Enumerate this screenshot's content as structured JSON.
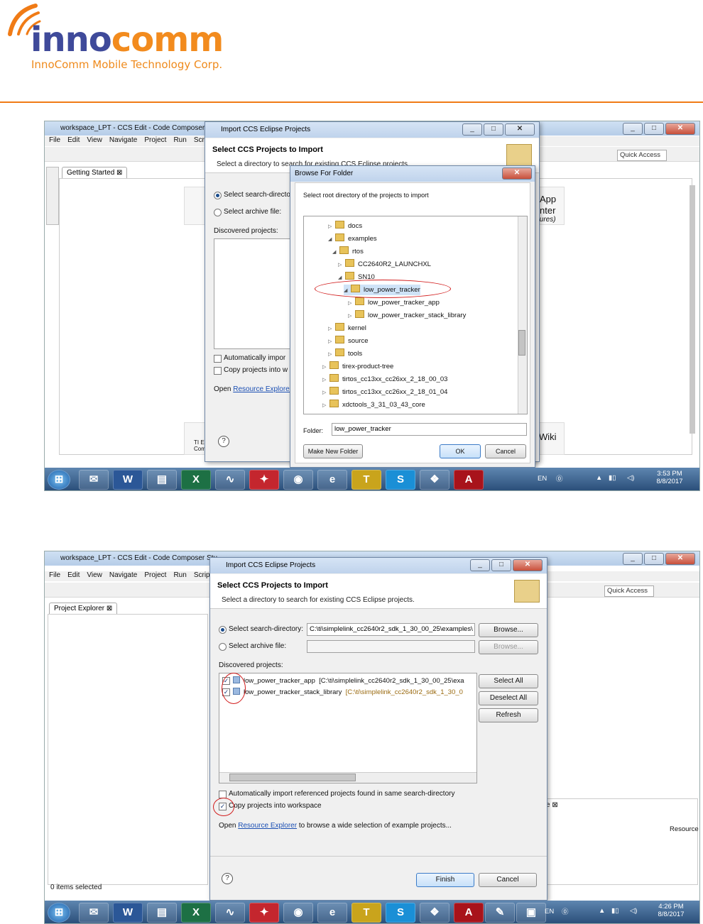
{
  "brand": {
    "logo_a": "inno",
    "logo_b": "comm",
    "tagline": "InnoComm Mobile Technology Corp.",
    "accent": "#f07b16",
    "logo_blue": "#3f4a9a"
  },
  "top": {
    "app_title": "workspace_LPT - CCS Edit - Code Composer Stu",
    "menu": [
      "File",
      "Edit",
      "View",
      "Navigate",
      "Project",
      "Run",
      "Scrip"
    ],
    "quick_access": "Quick Access",
    "editor_tab": "Getting Started",
    "bg_right_1": "App",
    "bg_right_2": "nter",
    "bg_right_3": "tures)",
    "bg_wiki": "Wiki",
    "bg_ti": "TI E",
    "bg_ti2": "Comm",
    "import_dialog": {
      "title": "Import CCS Eclipse Projects",
      "heading": "Select CCS Projects to Import",
      "subheading": "Select a directory to search for existing CCS Eclipse projects.",
      "radio_dir": "Select search-directo",
      "radio_archive": "Select archive file:",
      "discovered": "Discovered projects:",
      "chk_auto": "Automatically impor",
      "chk_copy": "Copy projects into w",
      "open_prefix": "Open",
      "open_link": "Resource Explorer"
    },
    "browse_dialog": {
      "title": "Browse For Folder",
      "prompt": "Select root directory of the projects to import",
      "tree": [
        "docs",
        "examples",
        "rtos",
        "CC2640R2_LAUNCHXL",
        "SN10",
        "low_power_tracker",
        "low_power_tracker_app",
        "low_power_tracker_stack_library",
        "kernel",
        "source",
        "tools",
        "tirex-product-tree",
        "tirtos_cc13xx_cc26xx_2_18_00_03",
        "tirtos_cc13xx_cc26xx_2_18_01_04",
        "xdctools_3_31_03_43_core"
      ],
      "folder_label": "Folder:",
      "folder_value": "low_power_tracker",
      "make_new": "Make New Folder",
      "ok": "OK",
      "cancel": "Cancel"
    },
    "tray": {
      "lang": "EN",
      "time": "3:53 PM",
      "date": "8/8/2017"
    }
  },
  "bottom": {
    "app_title": "workspace_LPT - CCS Edit - Code Composer Stu",
    "menu": [
      "File",
      "Edit",
      "View",
      "Navigate",
      "Project",
      "Run",
      "Scrip"
    ],
    "quick_access": "Quick Access",
    "explorer_tab": "Project Explorer",
    "status": "0 items selected",
    "side_tab": "e",
    "side_col": "Resource",
    "import_dialog": {
      "title": "Import CCS Eclipse Projects",
      "heading": "Select CCS Projects to Import",
      "subheading": "Select a directory to search for existing CCS Eclipse projects.",
      "radio_dir": "Select search-directory:",
      "dir_value": "C:\\ti\\simplelink_cc2640r2_sdk_1_30_00_25\\examples\\",
      "browse": "Browse...",
      "radio_archive": "Select archive file:",
      "browse2": "Browse...",
      "discovered": "Discovered projects:",
      "projects": [
        {
          "name": "low_power_tracker_app",
          "path": "[C:\\ti\\simplelink_cc2640r2_sdk_1_30_00_25\\exa"
        },
        {
          "name": "low_power_tracker_stack_library",
          "path": "[C:\\ti\\simplelink_cc2640r2_sdk_1_30_0"
        }
      ],
      "select_all": "Select All",
      "deselect_all": "Deselect All",
      "refresh": "Refresh",
      "chk_auto": "Automatically import referenced projects found in same search-directory",
      "chk_copy": "Copy projects into workspace",
      "open_prefix": "Open",
      "open_link": "Resource Explorer",
      "open_suffix": "to browse a wide selection of example projects...",
      "finish": "Finish",
      "cancel": "Cancel"
    },
    "tray": {
      "lang": "EN",
      "time": "4:26 PM",
      "date": "8/8/2017"
    }
  }
}
